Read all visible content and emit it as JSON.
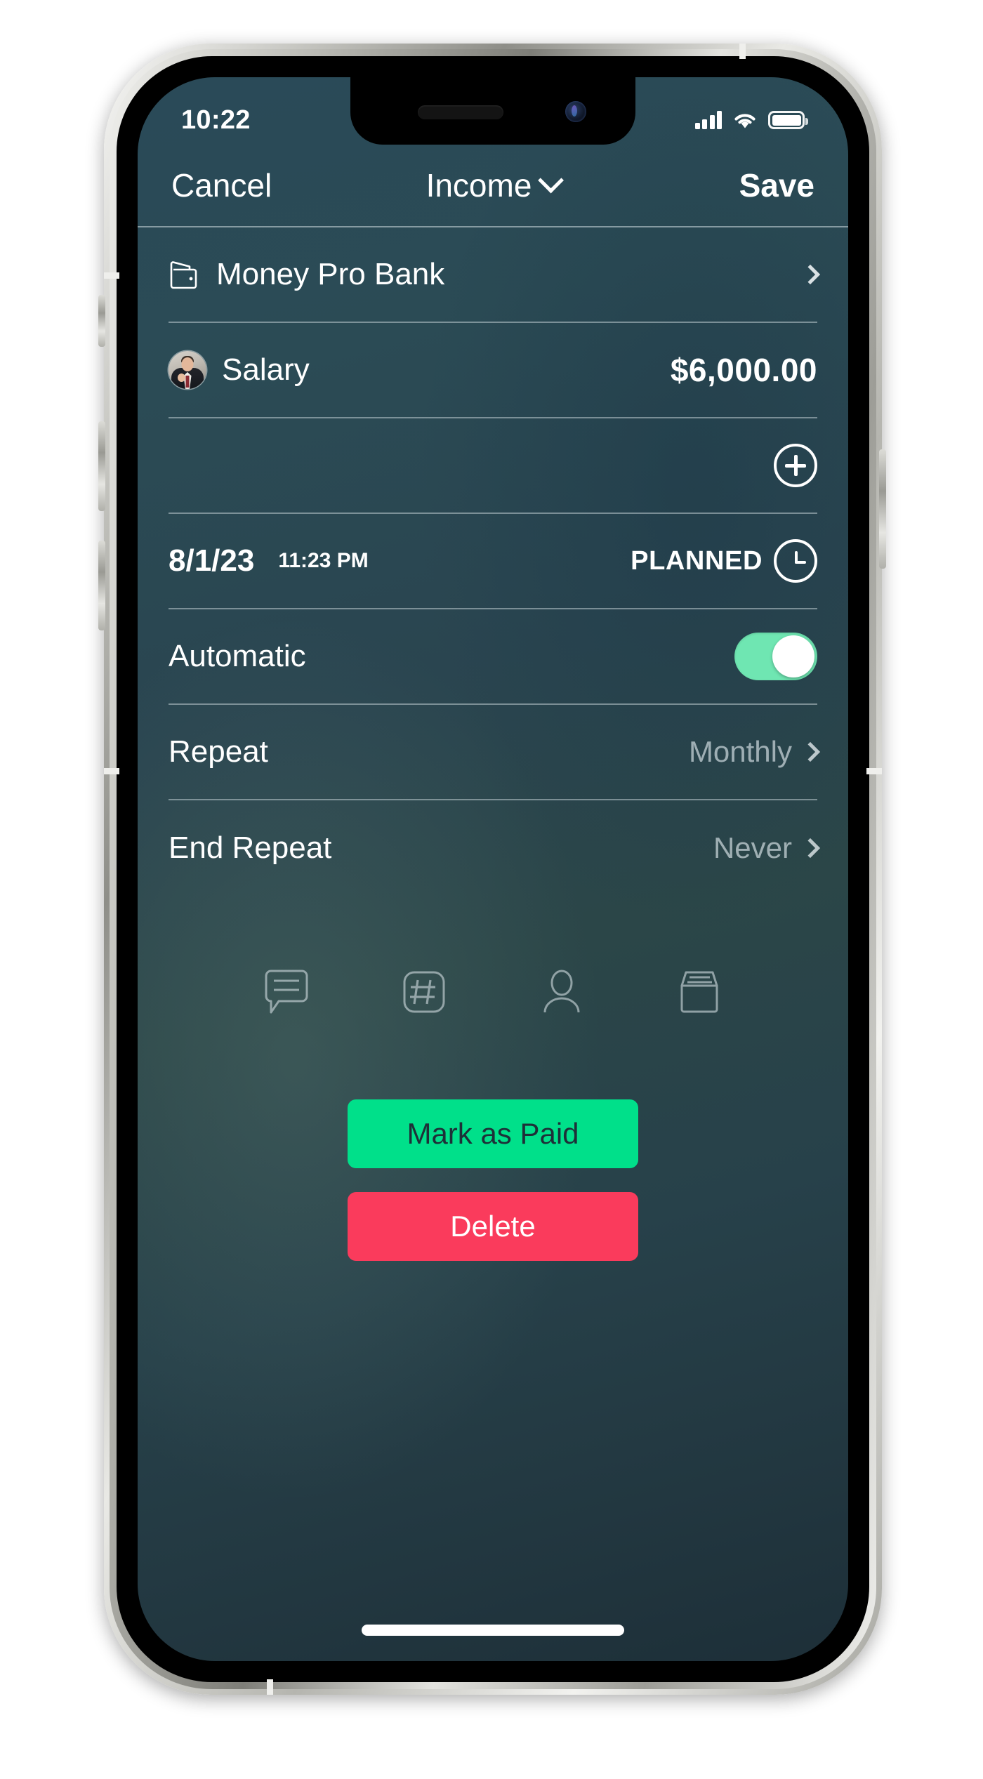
{
  "status_bar": {
    "time": "10:22",
    "cellular_icon": "cellular-bars-icon",
    "wifi_icon": "wifi-icon",
    "battery_icon": "battery-full-icon"
  },
  "nav": {
    "cancel_label": "Cancel",
    "title": "Income",
    "title_chevron_icon": "chevron-down-icon",
    "save_label": "Save"
  },
  "form": {
    "account": {
      "icon": "wallet-icon",
      "label": "Money Pro Bank",
      "chevron_icon": "chevron-right-icon"
    },
    "category": {
      "avatar_icon": "person-photo-avatar",
      "label": "Salary",
      "amount": "$6,000.00"
    },
    "add_row": {
      "add_icon": "plus-circle-icon"
    },
    "date_row": {
      "date": "8/1/23",
      "time": "11:23 PM",
      "status": "PLANNED",
      "clock_icon": "clock-icon"
    },
    "automatic": {
      "label": "Automatic",
      "toggle_state": "on"
    },
    "repeat": {
      "label": "Repeat",
      "value": "Monthly",
      "chevron_icon": "chevron-right-icon"
    },
    "end_repeat": {
      "label": "End Repeat",
      "value": "Never",
      "chevron_icon": "chevron-right-icon"
    }
  },
  "attachment_icons": [
    {
      "name": "comment-icon"
    },
    {
      "name": "hashtag-tag-icon"
    },
    {
      "name": "payee-person-icon"
    },
    {
      "name": "archive-box-icon"
    }
  ],
  "actions": {
    "mark_as_paid_label": "Mark as Paid",
    "delete_label": "Delete"
  },
  "colors": {
    "accent_green": "#00e08a",
    "toggle_green": "#6fe6b2",
    "delete_red": "#fa3b5c",
    "screen_bg_top": "#2a4a58",
    "screen_bg_bottom": "#1d2f38"
  }
}
